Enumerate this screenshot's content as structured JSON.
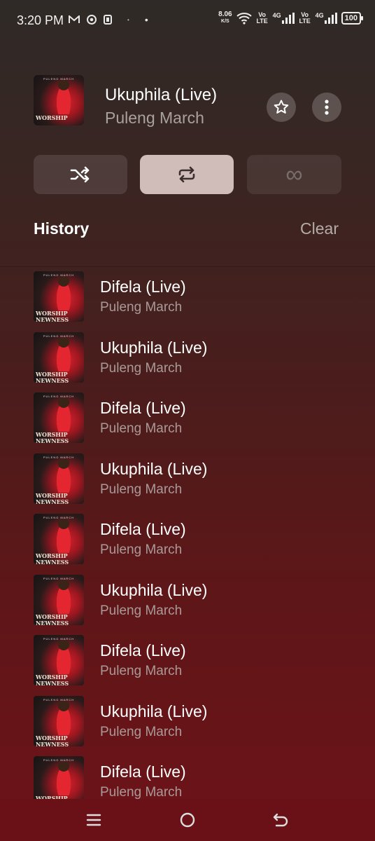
{
  "status_bar": {
    "time": "3:20 PM",
    "left_icons": [
      "gmail-icon",
      "chrome-icon",
      "app-icon",
      "dot-icon",
      "dot-icon"
    ],
    "net_speed_value": "8.06",
    "net_speed_unit": "K/S",
    "volte1": "Vo LTE",
    "net1": "4G",
    "volte2": "Vo LTE",
    "net2": "4G",
    "battery": "100"
  },
  "now_playing": {
    "title": "Ukuphila (Live)",
    "artist": "Puleng March",
    "cover_top_text": "PULENG MARCH",
    "cover_line1": "WORSHIP",
    "cover_line2": "NEWNESS"
  },
  "playback_modes": {
    "shuffle_icon": "shuffle-icon",
    "repeat_icon": "repeat-icon",
    "infinite_icon": "infinite-icon",
    "infinite_symbol": "∞",
    "active_mode": "repeat"
  },
  "history": {
    "title": "History",
    "clear_label": "Clear",
    "items": [
      {
        "title": "Difela (Live)",
        "artist": "Puleng March"
      },
      {
        "title": "Ukuphila (Live)",
        "artist": "Puleng March"
      },
      {
        "title": "Difela (Live)",
        "artist": "Puleng March"
      },
      {
        "title": "Ukuphila (Live)",
        "artist": "Puleng March"
      },
      {
        "title": "Difela (Live)",
        "artist": "Puleng March"
      },
      {
        "title": "Ukuphila (Live)",
        "artist": "Puleng March"
      },
      {
        "title": "Difela (Live)",
        "artist": "Puleng March"
      },
      {
        "title": "Ukuphila (Live)",
        "artist": "Puleng March"
      },
      {
        "title": "Difela (Live)",
        "artist": "Puleng March"
      }
    ]
  },
  "nav_bar": {
    "icons": [
      "menu-icon",
      "home-icon",
      "back-icon"
    ]
  },
  "colors": {
    "accent_button": "#ebd7d2",
    "background_top": "#2f2a27",
    "background_bottom": "#6d1319"
  }
}
